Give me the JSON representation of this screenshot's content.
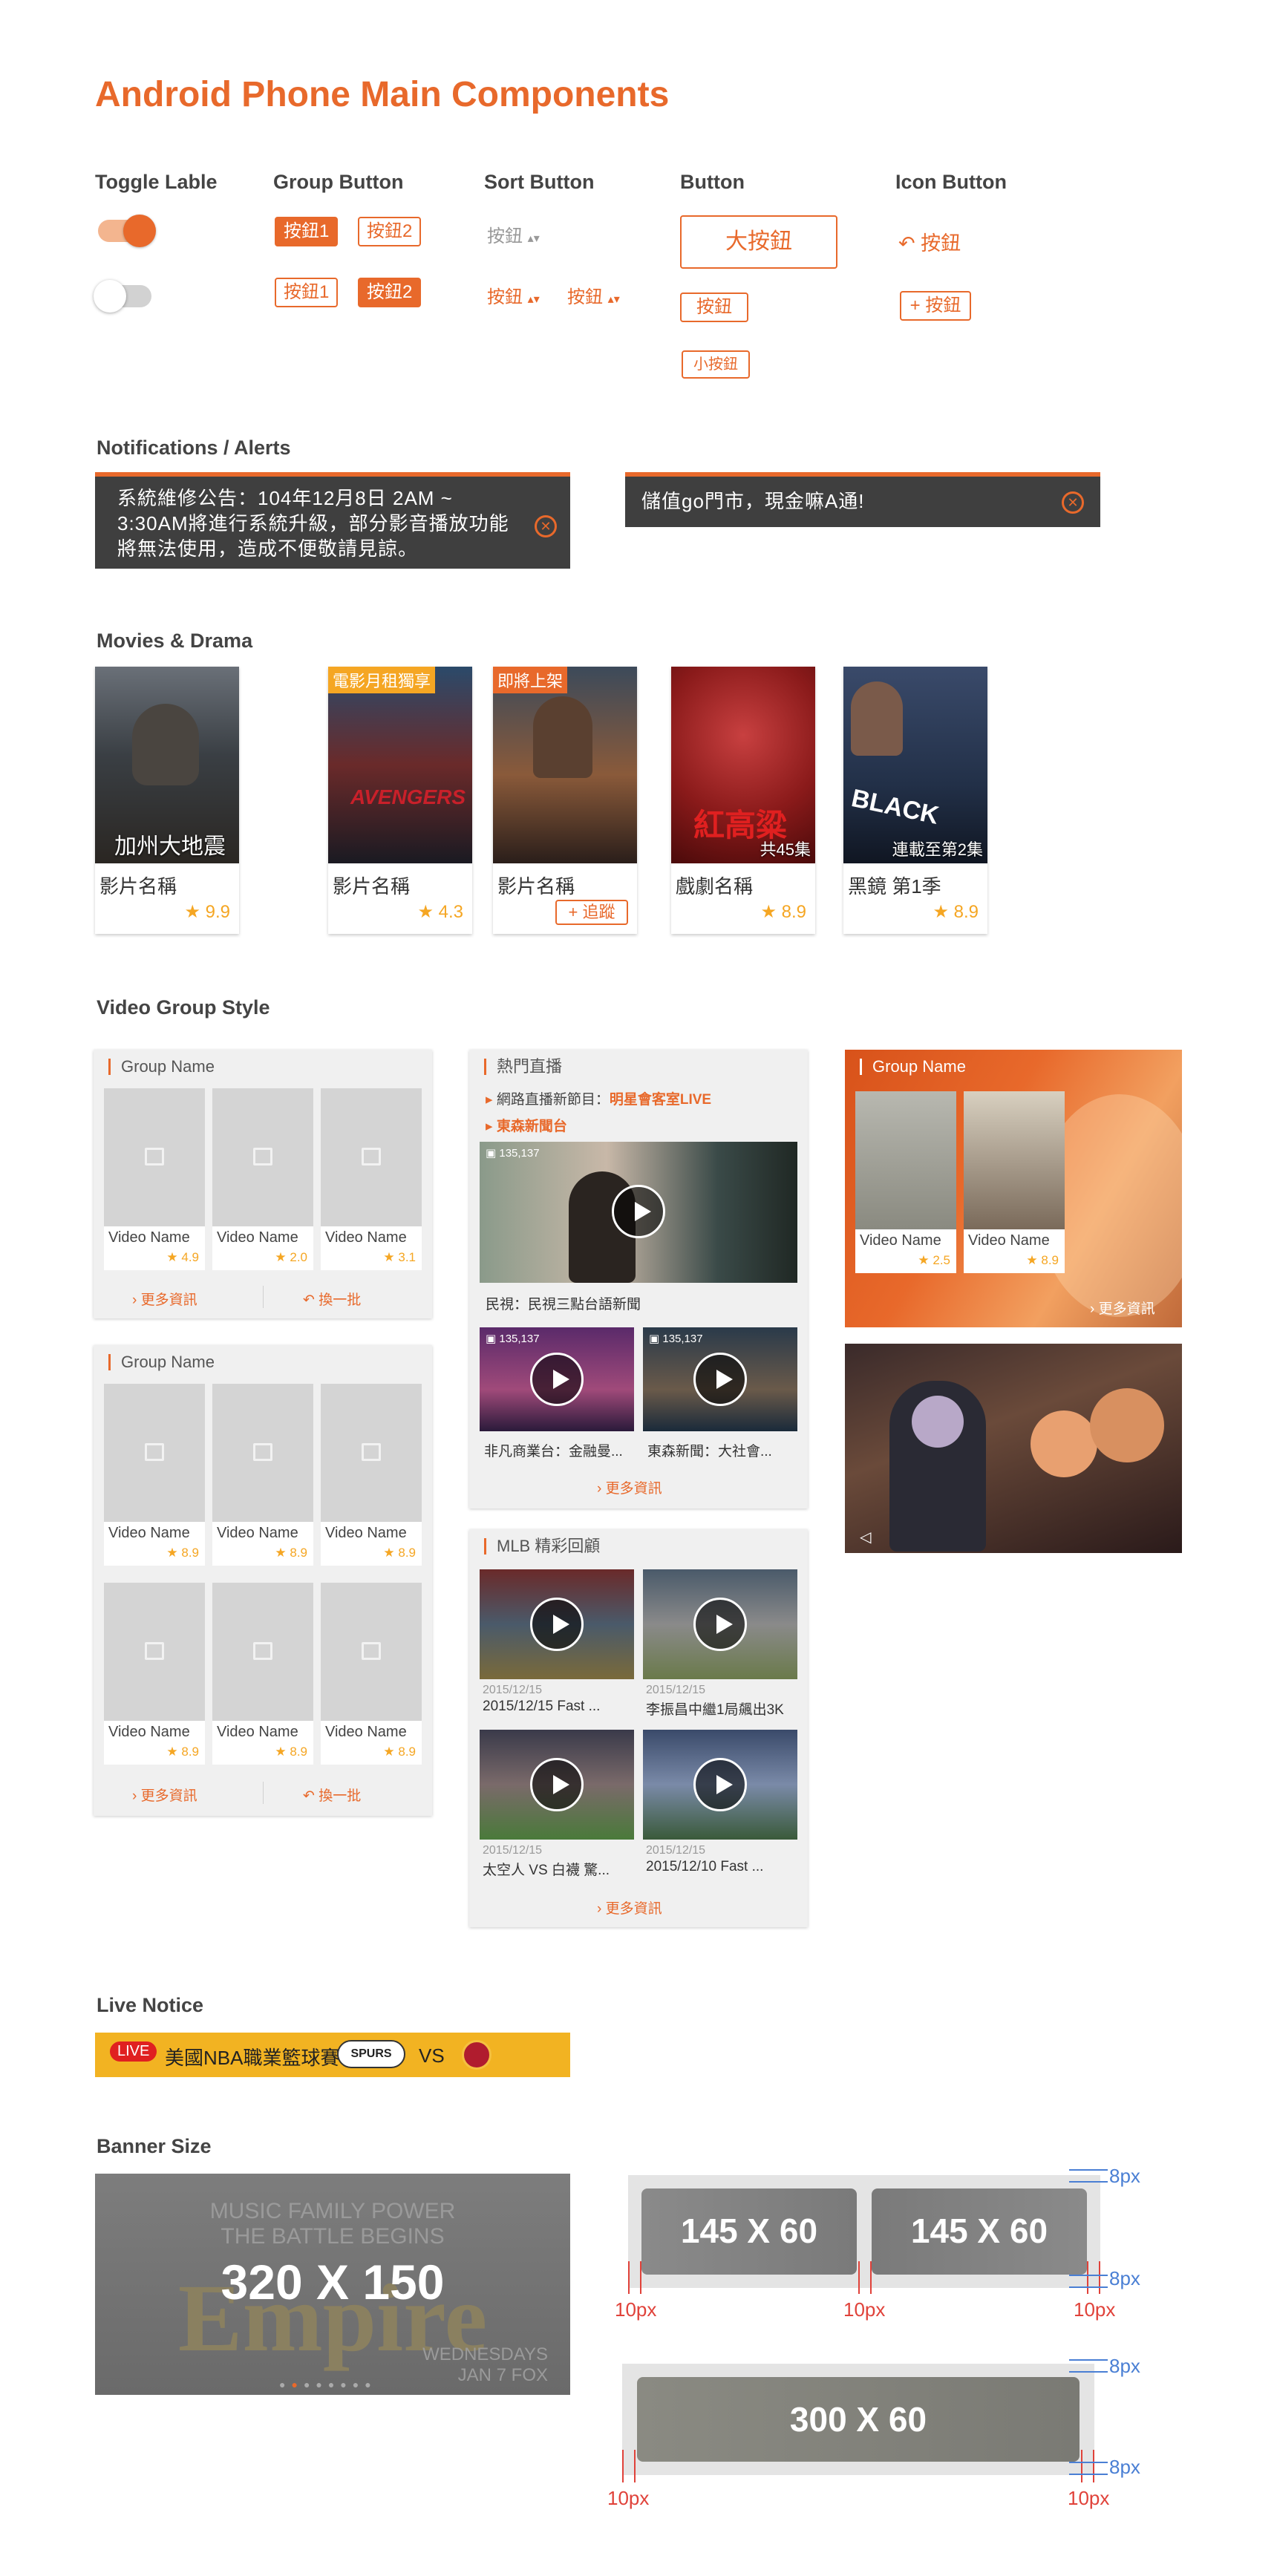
{
  "page": {
    "title": "Android Phone Main Components"
  },
  "components": {
    "toggle_label": "Toggle Lable",
    "group_button_title": "Group Button",
    "sort_button_title": "Sort Button",
    "button_title": "Button",
    "icon_button_title": "Icon Button",
    "group_row1": [
      "按鈕1",
      "按鈕2"
    ],
    "group_row2": [
      "按鈕1",
      "按鈕2"
    ],
    "sort_labels": [
      "按鈕",
      "按鈕",
      "按鈕"
    ],
    "sort_arrows": "▴▾",
    "large_button": "大按鈕",
    "medium_button": "按鈕",
    "small_button": "小按鈕",
    "icon_button_undo": "按鈕",
    "icon_button_add": "按鈕",
    "undo_glyph": "↶",
    "plus_glyph": "+"
  },
  "notifications": {
    "title": "Notifications / Alerts",
    "maintenance_text": "系統維修公告：104年12月8日 2AM ~ 3:30AM將進行系統升級，部分影音播放功能將無法使用，造成不便敬請見諒。",
    "market_text": "儲值go門市，現金嘛A通!",
    "close_glyph": "✕"
  },
  "movies": {
    "title": "Movies & Drama",
    "items": [
      {
        "caption": "加州大地震",
        "name": "影片名稱",
        "rating": "9.9"
      },
      {
        "badge": "電影月租獨享",
        "name": "影片名稱",
        "rating": "4.3"
      },
      {
        "badge": "即將上架",
        "name": "影片名稱",
        "follow": "+ 追蹤"
      },
      {
        "sub": "共45集",
        "name": "戲劇名稱",
        "rating": "8.9"
      },
      {
        "sub": "連載至第2集",
        "name": "黑鏡 第1季",
        "rating": "8.9"
      }
    ],
    "star": "★"
  },
  "video_groups": {
    "title": "Video Group Style",
    "group_name": "Group Name",
    "video_name": "Video Name",
    "more": "更多資訊",
    "refresh": "換一批",
    "panel1_ratings": [
      "4.9",
      "2.0",
      "3.1"
    ],
    "panel2_ratings": [
      "8.9",
      "8.9",
      "8.9",
      "8.9",
      "8.9",
      "8.9"
    ],
    "panel3_ratings": [
      "2.5",
      "8.9"
    ],
    "hot_live": {
      "title": "熱門直播",
      "row1_prefix": "網路直播新節目：",
      "row1_highlight": "明星會客室LIVE",
      "row2": "東森新聞台",
      "view_count": "135,137",
      "main_caption": "民視：民視三點台語新聞",
      "small_caption1": "非凡商業台：金融曼...",
      "small_caption2": "東森新聞：大社會..."
    },
    "mlb": {
      "title": "MLB 精彩回顧",
      "items": [
        {
          "date": "2015/12/15",
          "caption": "2015/12/15 Fast ..."
        },
        {
          "date": "2015/12/15",
          "caption": "李振昌中繼1局飆出3K"
        },
        {
          "date": "2015/12/15",
          "caption": "太空人 VS 白襪 驚..."
        },
        {
          "date": "2015/12/15",
          "caption": "2015/12/10 Fast ..."
        }
      ]
    },
    "more_glyph": "›",
    "refresh_glyph": "↶"
  },
  "live_notice": {
    "title": "Live Notice",
    "badge": "LIVE",
    "text": "美國NBA職業籃球賽",
    "team1": "SPURS",
    "vs": "VS"
  },
  "banners": {
    "title": "Banner Size",
    "large_label": "320 X 150",
    "large_bg_line1": "MUSIC FAMILY POWER",
    "large_bg_line2": "THE BATTLE BEGINS",
    "large_bg_word": "Empire",
    "large_bg_date": "WEDNESDAYS JAN 7 FOX",
    "small_label": "145 X 60",
    "wide_label": "300 X 60",
    "gap_label": "10px",
    "edge_label": "8px"
  }
}
